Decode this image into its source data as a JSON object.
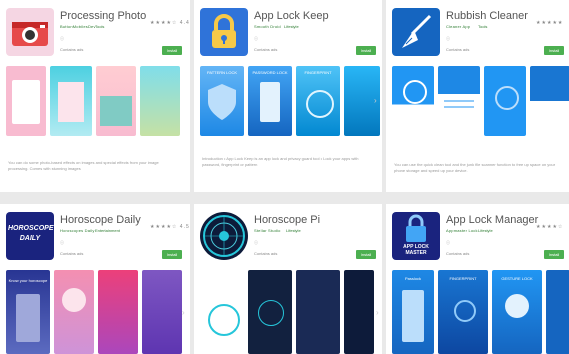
{
  "apps": [
    {
      "id": "processing-photo",
      "title": "Processing Photo",
      "developer": "ButtonMobilesDev",
      "category": "Tools",
      "rating_text": "★★★★☆ 4.4",
      "badge_text": "Contains ads",
      "install_label": "Install",
      "description": "You can do some photo-based effects on images and special effects from your image processing. Comes with stunning images",
      "colors": {
        "icon_bg": "#f5d6e3",
        "accent": "#e64a4a"
      }
    },
    {
      "id": "app-lock-keep",
      "title": "App Lock Keep",
      "developer": "Smooth Droid",
      "category": "Lifestyle",
      "rating_text": "",
      "badge_text": "Contains ads",
      "install_label": "Install",
      "shot_labels": [
        "PATTERN LOCK",
        "PASSWORD LOCK",
        "FINGERPRINT"
      ],
      "description": "Introduction • App Lock Keep is an app lock and privacy guard tool • Lock your apps with password, fingerprint or pattern",
      "colors": {
        "icon_bg": "#2f73d9",
        "accent": "#f7c948"
      }
    },
    {
      "id": "rubbish-cleaner",
      "title": "Rubbish Cleaner",
      "developer": "Cleaner App",
      "category": "Tools",
      "rating_text": "★★★★★",
      "badge_text": "Contains ads",
      "install_label": "Install",
      "description": "You can use the quick clean tool and the junk file scanner function to free up space on your phone storage and speed up your device.",
      "colors": {
        "icon_bg": "#1565c0",
        "accent": "#2196f3"
      }
    },
    {
      "id": "horoscope-daily",
      "title": "Horoscope Daily",
      "developer": "Horoscopes Daily",
      "category": "Entertainment",
      "rating_text": "★★★★☆ 4.5",
      "badge_text": "Contains ads",
      "install_label": "Install",
      "icon_text": "HOROSCOPE DAILY",
      "shot_labels": [
        "Know your horoscope"
      ],
      "colors": {
        "icon_bg": "#1a237e",
        "accent": "#ec407a"
      }
    },
    {
      "id": "horoscope-pi",
      "title": "Horoscope Pi",
      "developer": "Stellar Studio",
      "category": "Lifestyle",
      "rating_text": "",
      "badge_text": "Contains ads",
      "install_label": "Install",
      "colors": {
        "icon_bg": "#0d1b3a",
        "accent": "#26c6da"
      }
    },
    {
      "id": "app-lock-manager",
      "title": "App Lock Manager",
      "developer": "Appmaster Lock",
      "category": "Lifestyle",
      "rating_text": "★★★★☆",
      "badge_text": "Contains ads",
      "install_label": "Install",
      "icon_text": "APP LOCK MASTER",
      "shot_labels": [
        "Passlock",
        "FINGERPRINT",
        "GESTURE LOCK"
      ],
      "colors": {
        "icon_bg": "#1a237e",
        "accent": "#2962ff"
      }
    }
  ]
}
